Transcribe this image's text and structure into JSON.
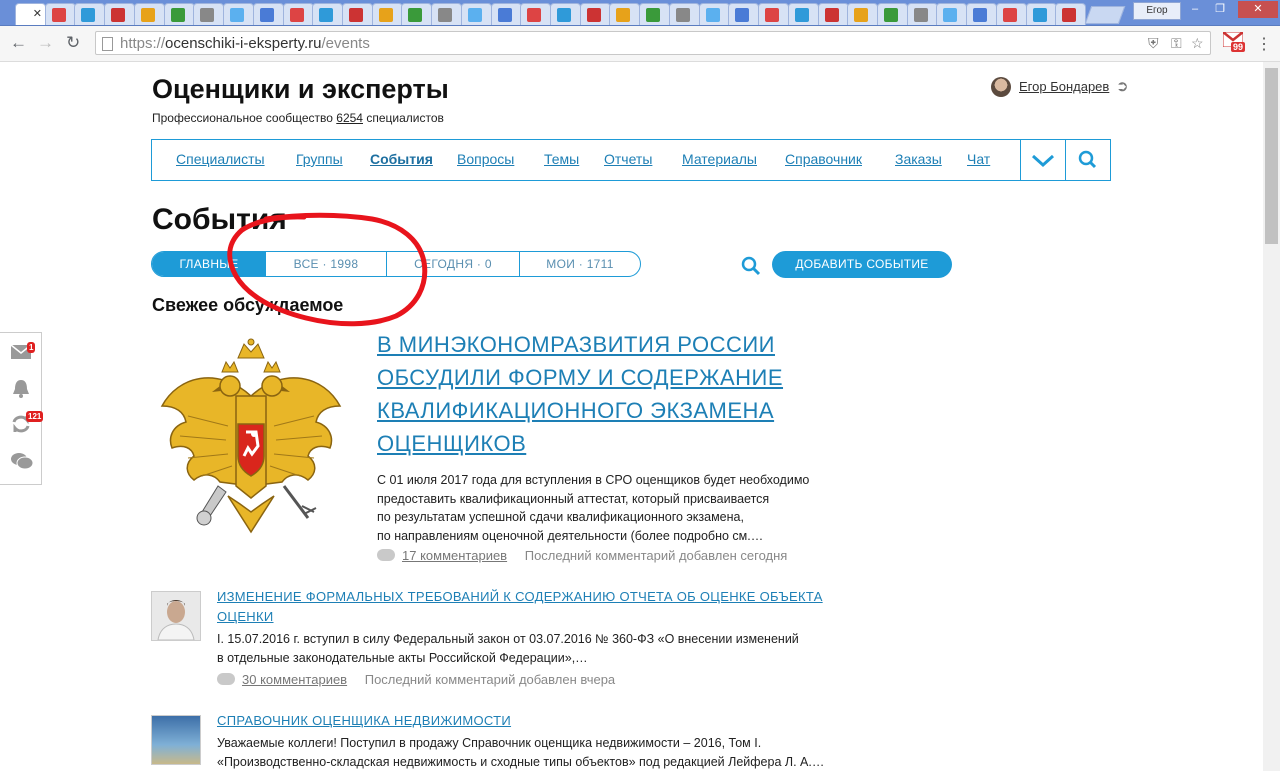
{
  "browser": {
    "tabs_count": 36,
    "user_chip": "Егор",
    "url_scheme": "https://",
    "url_host": "ocenschiki-i-eksperty.ru",
    "url_path": "/events",
    "gmail_badge": "99"
  },
  "site": {
    "title": "Оценщики и эксперты",
    "subtitle_prefix": "Профессиональное сообщество",
    "subtitle_count": "6254",
    "subtitle_suffix": "специалистов",
    "user_name": "Егор Бондарев"
  },
  "nav": {
    "items": [
      {
        "label": "Специалисты"
      },
      {
        "label": "Группы"
      },
      {
        "label": "События"
      },
      {
        "label": "Вопросы"
      },
      {
        "label": "Темы"
      },
      {
        "label": "Отчеты"
      },
      {
        "label": "Материалы"
      },
      {
        "label": "Справочник"
      },
      {
        "label": "Заказы"
      },
      {
        "label": "Чат"
      }
    ]
  },
  "events": {
    "heading": "События",
    "pills": [
      {
        "label": "ГЛАВНЫЕ"
      },
      {
        "label": "ВСЕ · 1998"
      },
      {
        "label": "СЕГОДНЯ · 0"
      },
      {
        "label": "МОИ · 1711"
      }
    ],
    "add_button": "ДОБАВИТЬ СОБЫТИЕ",
    "section_heading": "Свежее обсуждаемое"
  },
  "featured": {
    "title": "В МИНЭКОНОМРАЗВИТИЯ РОССИИ ОБСУДИЛИ ФОРМУ И СОДЕРЖАНИЕ КВАЛИФИКАЦИОННОГО ЭКЗАМЕНА ОЦЕНЩИКОВ",
    "text_lines": [
      "С 01 июля 2017 года для вступления в СРО оценщиков будет необходимо",
      "предоставить квалификационный аттестат, который присваивается",
      "по результатам успешной сдачи квалификационного экзамена,",
      "по направлениям оценочной деятельности (более подробно см.…"
    ],
    "comments": "17 комментариев",
    "last": "Последний комментарий добавлен сегодня"
  },
  "items": [
    {
      "title_lines": [
        "ИЗМЕНЕНИЕ ФОРМАЛЬНЫХ ТРЕБОВАНИЙ К СОДЕРЖАНИЮ ОТЧЕТА ОБ ОЦЕНКЕ ОБЪЕКТА",
        "ОЦЕНКИ"
      ],
      "text_lines": [
        "I. 15.07.2016 г. вступил в силу Федеральный закон от 03.07.2016 № 360-ФЗ «О внесении изменений",
        "в отдельные законодательные акты Российской Федерации»,…"
      ],
      "comments": "30 комментариев",
      "last": "Последний комментарий добавлен вчера"
    },
    {
      "title_lines": [
        "СПРАВОЧНИК ОЦЕНЩИКА НЕДВИЖИМОСТИ"
      ],
      "text_lines": [
        "Уважаемые коллеги! Поступил в продажу Справочник оценщика недвижимости – 2016, Том I.",
        "«Производственно-складская недвижимость и сходные типы объектов» под редакцией Лейфера Л. А.…"
      ]
    }
  ],
  "side_widget": {
    "mail_badge": "1",
    "updates_badge": "121"
  },
  "colors": {
    "accent": "#1e9bd7",
    "link": "#1d7fb5",
    "annotation": "#e8141c"
  }
}
